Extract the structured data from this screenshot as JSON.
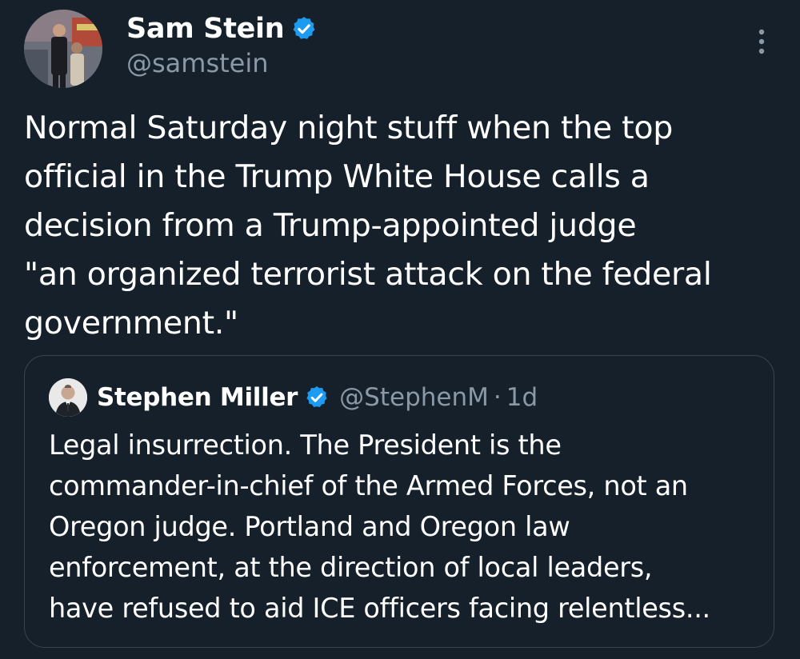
{
  "tweet": {
    "author": {
      "name": "Sam Stein",
      "handle": "@samstein",
      "verified": true
    },
    "text": "Normal Saturday night stuff when the top\nofficial in the Trump White House calls a\ndecision from a Trump-appointed judge\n\"an organized terrorist attack on the federal\ngovernment.\"",
    "more_icon": "more-vertical-icon"
  },
  "quote": {
    "author": {
      "name": "Stephen Miller",
      "handle": "@StephenM",
      "verified": true
    },
    "separator": "·",
    "time": "1d",
    "text": "Legal insurrection. The President is the\ncommander-in-chief of the Armed Forces, not an\nOregon judge. Portland and Oregon law\nenforcement, at the direction of local leaders,\nhave refused to aid ICE officers facing relentless..."
  },
  "colors": {
    "background": "#15202b",
    "text_primary": "#ffffff",
    "text_secondary": "#8b98a5",
    "verified_badge": "#1d9bf0",
    "border": "#38444d"
  }
}
